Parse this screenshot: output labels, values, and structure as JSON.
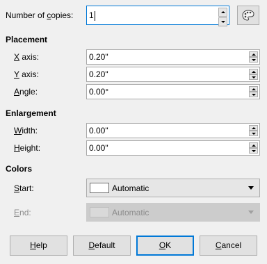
{
  "copies": {
    "label_pre": "Number of ",
    "label_u": "c",
    "label_post": "opies:",
    "value": "1",
    "palette_icon": "palette-icon"
  },
  "placement": {
    "heading": "Placement",
    "x_label_u": "X",
    "x_label_post": " axis:",
    "x_value": "0.20\"",
    "y_label_u": "Y",
    "y_label_post": " axis:",
    "y_value": "0.20\"",
    "angle_label_u": "A",
    "angle_label_post": "ngle:",
    "angle_value": "0.00°"
  },
  "enlargement": {
    "heading": "Enlargement",
    "width_label_u": "W",
    "width_label_post": "idth:",
    "width_value": "0.00\"",
    "height_label_u": "H",
    "height_label_post": "eight:",
    "height_value": "0.00\""
  },
  "colors": {
    "heading": "Colors",
    "start_label_u": "S",
    "start_label_post": "tart:",
    "start_value": "Automatic",
    "end_label_u": "E",
    "end_label_post": "nd:",
    "end_value": "Automatic"
  },
  "buttons": {
    "help_u": "H",
    "help_post": "elp",
    "default_u": "D",
    "default_post": "efault",
    "ok_u": "O",
    "ok_post": "K",
    "cancel_u": "C",
    "cancel_post": "ancel"
  },
  "colors_theme": {
    "focus_border": "#0078d7",
    "background": "#f0f0f0"
  }
}
